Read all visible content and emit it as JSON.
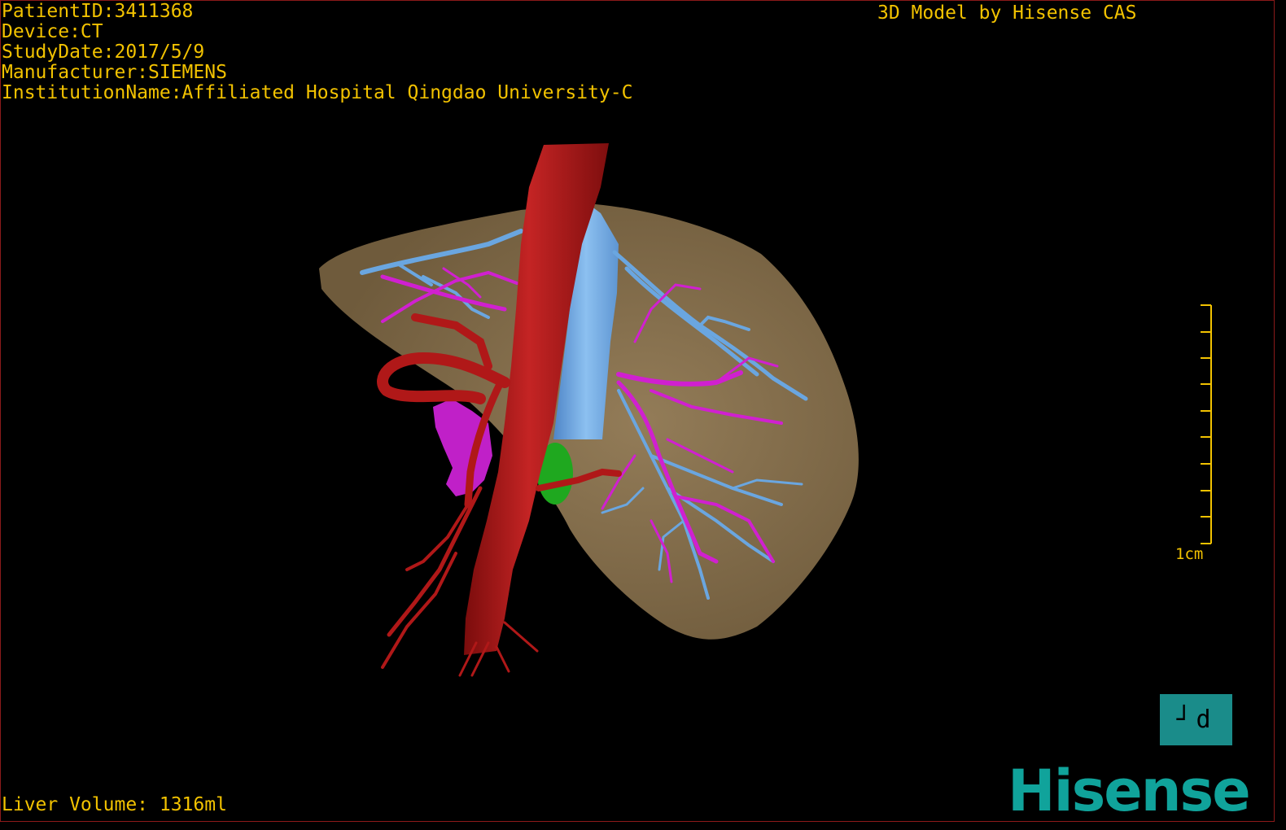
{
  "dicom": {
    "patient_id": "PatientID:3411368",
    "device": "Device:CT",
    "study_date": "StudyDate:2017/5/9",
    "manufacturer": "Manufacturer:SIEMENS",
    "institution": "InstitutionName:Affiliated Hospital Qingdao University-C"
  },
  "credit": "3D Model by Hisense CAS",
  "liver_volume": "Liver Volume: 1316ml",
  "scale_label": "1cm",
  "orientation_button": "┘d",
  "logo_text": "Hisense",
  "colors": {
    "text": "#f2c200",
    "liver": "#8a7350",
    "artery": "#b01818",
    "portal_vein": "#6aa6e0",
    "hepatic_vein": "#d020d0",
    "gallbladder": "#20b020",
    "brand": "#10a39b"
  }
}
